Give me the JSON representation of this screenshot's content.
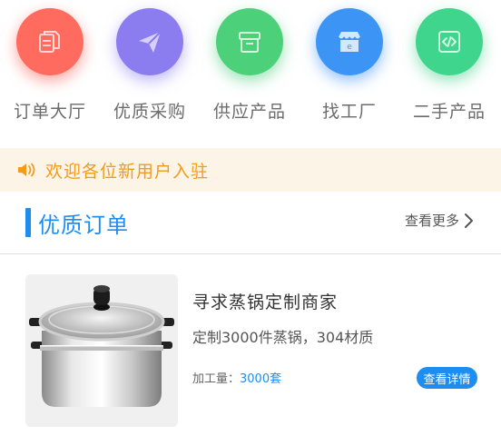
{
  "nav": {
    "items": [
      {
        "label": "订单大厅",
        "icon": "document-icon",
        "color": "#ff6b5e"
      },
      {
        "label": "优质采购",
        "icon": "paper-plane-icon",
        "color": "#8b7cf0"
      },
      {
        "label": "供应产品",
        "icon": "box-icon",
        "color": "#4cd07a"
      },
      {
        "label": "找工厂",
        "icon": "storefront-icon",
        "color": "#3c95f5"
      },
      {
        "label": "二手产品",
        "icon": "code-icon",
        "color": "#3fd58c"
      }
    ]
  },
  "notice": {
    "text": "欢迎各位新用户入驻",
    "color": "#f39a1c",
    "icon": "speaker-icon"
  },
  "section": {
    "title": "优质订单",
    "more_label": "查看更多",
    "accent": "#1e8df0"
  },
  "order": {
    "title": "寻求蒸锅定制商家",
    "description": "定制3000件蒸锅，304材质",
    "qty_label": "加工量：",
    "qty_value": "3000套",
    "detail_label": "查看详情",
    "image": "steamer-pot-image"
  }
}
